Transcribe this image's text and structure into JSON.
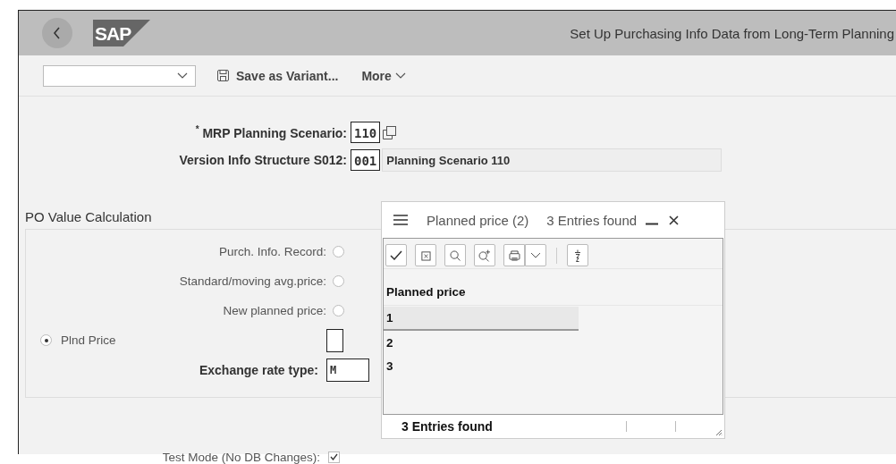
{
  "header": {
    "logo": "SAP",
    "title": "Set Up Purchasing Info Data from Long-Term Planning"
  },
  "toolbar": {
    "items": [
      {
        "kind": "save",
        "label": "Save as Variant..."
      },
      {
        "kind": "more",
        "label": "More"
      }
    ]
  },
  "selection": {
    "fields": [
      {
        "label": "$^{*}$ MRP Planning Scenario:",
        "value_help": true,
        "value": "110"
      },
      {
        "label": "Version Info Structure S012:",
        "value_help": false,
        "value": "001",
        "description": "Planning Scenario 110"
      }
    ]
  },
  "po_value_calculation": {
    "title": "PO Value Calculation",
    "options": [
      {
        "kind": "label_left",
        "label": "Purch. Info. Record:",
        "selected": false
      },
      {
        "kind": "label_left",
        "label": "Standard/moving avg.price:",
        "selected": false
      },
      {
        "kind": "label_left",
        "label": "New planned price:",
        "selected": false
      },
      {
        "kind": "label_right",
        "label": "Plnd Price",
        "selected": true
      }
    ],
    "exchange_rate": {
      "label": "Exchange rate type:",
      "value": "M"
    }
  },
  "test_mode": {
    "label": "Test Mode (No DB Changes):",
    "checked": true
  },
  "popup": {
    "title": "Planned price (2)",
    "count": "3 Entries found",
    "column": "Planned price",
    "rows": [
      {
        "value": "1",
        "selected": true
      },
      {
        "value": "2",
        "selected": false
      },
      {
        "value": "3",
        "selected": false
      }
    ],
    "status": "3 Entries found"
  }
}
